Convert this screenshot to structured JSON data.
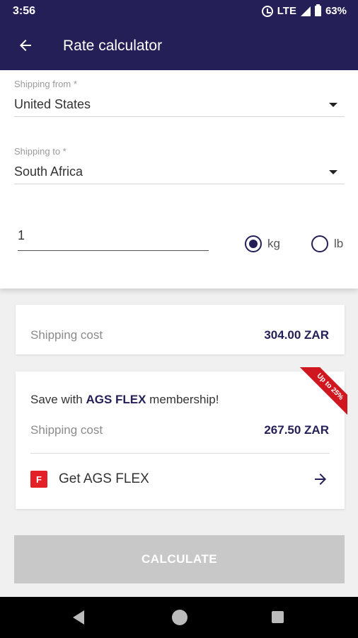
{
  "status_bar": {
    "time": "3:56",
    "network": "LTE",
    "battery": "63%"
  },
  "app_bar": {
    "title": "Rate calculator"
  },
  "form": {
    "shipping_from": {
      "label": "Shipping from *",
      "value": "United States"
    },
    "shipping_to": {
      "label": "Shipping to *",
      "value": "South Africa"
    },
    "weight": "1",
    "units": [
      {
        "label": "kg",
        "selected": true
      },
      {
        "label": "lb",
        "selected": false
      }
    ]
  },
  "standard": {
    "label": "Shipping cost",
    "value": "304.00 ZAR"
  },
  "flex": {
    "ribbon": "Up to 25%",
    "save_prefix": "Save with ",
    "save_brand": "AGS FLEX",
    "save_suffix": " membership!",
    "cost_label": "Shipping cost",
    "cost_value": "267.50 ZAR",
    "badge": "F",
    "cta": "Get AGS FLEX"
  },
  "calculate_label": "CALCULATE",
  "colors": {
    "primary": "#241f57",
    "brand_red": "#d0171f",
    "button_disabled": "#c8c8c8"
  }
}
